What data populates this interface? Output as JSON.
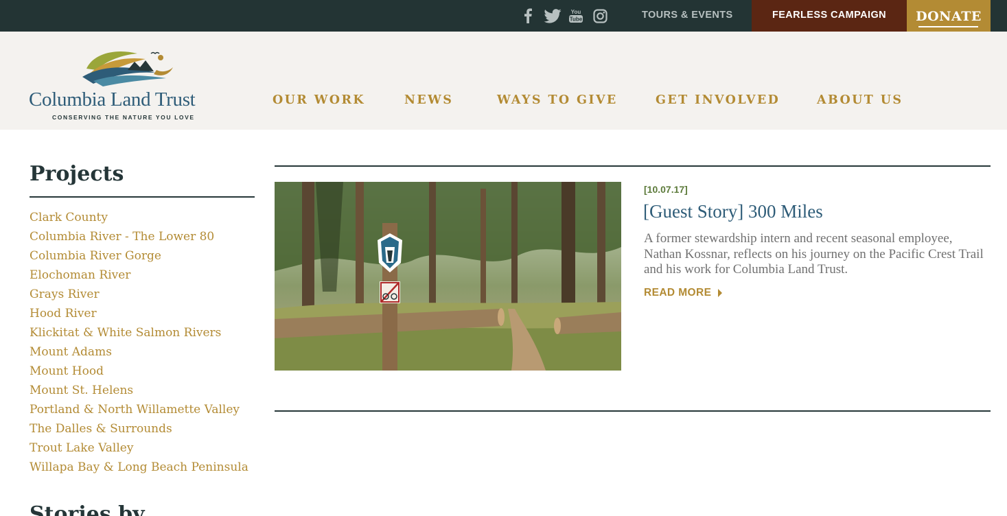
{
  "topbar": {
    "social": [
      "facebook-icon",
      "twitter-icon",
      "youtube-icon",
      "instagram-icon"
    ],
    "tours_label": "TOURS & EVENTS",
    "fearless_label": "FEARLESS CAMPAIGN",
    "donate_label": "DONATE"
  },
  "logo": {
    "name": "Columbia Land Trust",
    "tagline": "CONSERVING THE NATURE YOU LOVE"
  },
  "nav": {
    "items": [
      "OUR WORK",
      "NEWS",
      "WAYS TO GIVE",
      "GET INVOLVED",
      "ABOUT US"
    ]
  },
  "sidebar": {
    "title": "Projects",
    "items": [
      "Clark County",
      "Columbia River - The Lower 80",
      "Columbia River Gorge",
      "Elochoman River",
      "Grays River",
      "Hood River",
      "Klickitat & White Salmon Rivers",
      "Mount Adams",
      "Mount Hood",
      "Mount St. Helens",
      "Portland & North Willamette Valley",
      "The Dalles & Surrounds",
      "Trout Lake Valley",
      "Willapa Bay & Long Beach Peninsula"
    ],
    "next_section_title": "Stories by"
  },
  "article": {
    "date": "[10.07.17]",
    "title": "[Guest Story] 300 Miles",
    "excerpt": "A former stewardship intern and recent seasonal employee, Nathan Kossnar, reflects on his journey on the Pacific Crest Trail and his work for Columbia Land Trust.",
    "read_more": "READ MORE"
  },
  "colors": {
    "topbar": "#233434",
    "header": "#f4f2ef",
    "accent_gold": "#b38b34",
    "fearless_bg": "#5b2613",
    "title_blue": "#2e5c78",
    "date_green": "#5c7a3a"
  }
}
